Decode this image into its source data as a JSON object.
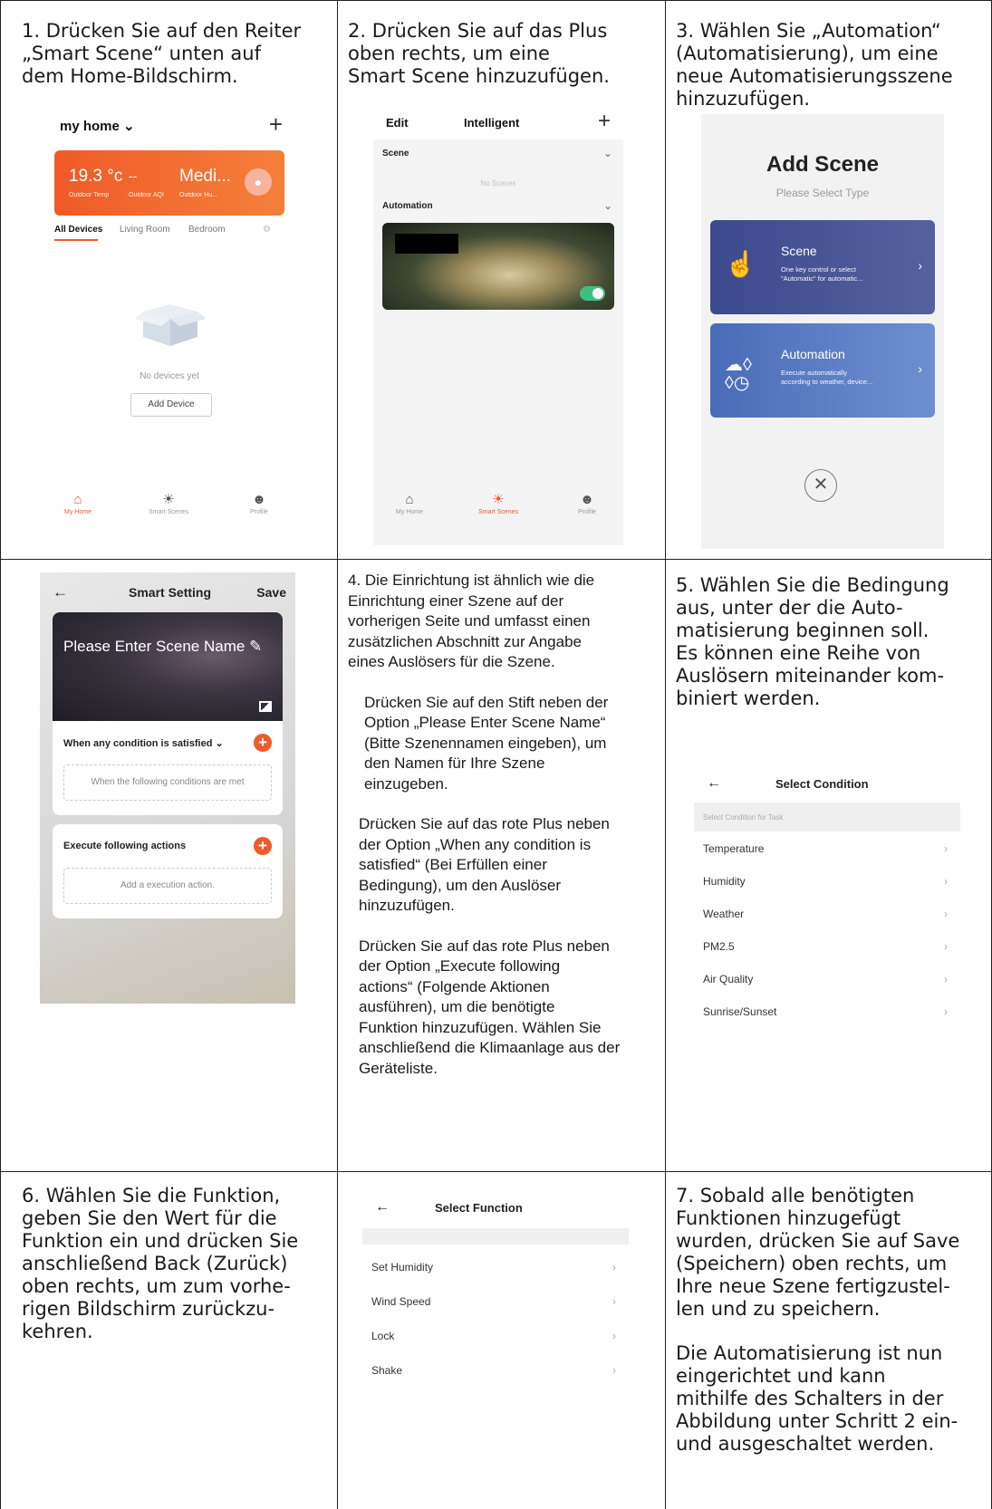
{
  "cells": {
    "c1": "1. Drücken Sie auf den Reiter\n„Smart Scene“ unten auf\ndem Home-Bildschirm.",
    "c2": "2. Drücken Sie auf das Plus\noben rechts, um eine\nSmart Scene hinzuzufügen.",
    "c3": "3. Wählen Sie „Automation“\n(Automatisierung), um eine\nneue Automatisierungsszene\nhinzuzufügen.",
    "c4": [
      "4. Die Einrichtung ist ähnlich wie die\nEinrichtung einer Szene auf der\nvorherigen Seite und umfasst einen\nzusätzlichen Abschnitt zur Angabe\neines Auslösers für die Szene.",
      "Drücken Sie auf den Stift neben der\nOption „Please Enter Scene Name“\n(Bitte Szenennamen eingeben), um\nden Namen für Ihre Szene\neinzugeben.",
      "Drücken Sie auf das rote Plus neben\nder Option „When any condition is\nsatisfied“ (Bei Erfüllen einer\nBedingung), um den Auslöser\nhinzuzufügen.",
      "Drücken Sie auf das rote Plus neben\nder Option „Execute following\nactions“ (Folgende Aktionen\nausführen), um die benötigte\nFunktion hinzuzufügen. Wählen Sie\nanschließend die Klimaanlage aus der\nGeräteliste."
    ],
    "c5": "5. Wählen Sie die Bedingung\naus, unter der die Auto-\nmatisierung beginnen soll.\nEs können eine Reihe von\nAuslösern miteinander kom-\nbiniert werden.",
    "c6": "6. Wählen Sie die Funktion,\ngeben Sie den Wert für die\nFunktion ein und drücken Sie\nanschließend Back (Zurück)\noben rechts, um zum vorhe-\nrigen Bildschirm zurückzu-\nkehren.",
    "c7a": "7. Sobald alle benötigten\nFunktionen hinzugefügt\nwurden, drücken Sie auf Save\n(Speichern) oben rechts, um\nIhre neue Szene fertigzustel-\nlen und zu speichern.",
    "c7b": "Die Automatisierung ist nun\neingerichtet und kann\nmithilfe des Schalters in der\nAbbildung unter Schritt 2 ein-\nund ausgeschaltet werden."
  },
  "screen1": {
    "home": "my home ⌄",
    "plus": "+",
    "temp": "19.3 °c",
    "temp_label": "Outdoor Temp",
    "aqi": "--",
    "aqi_label": "Outdoor AQI",
    "hum": "Medi...",
    "hum_label": "Outdoor Hu...",
    "tabs": [
      "All Devices",
      "Living Room",
      "Bedroom"
    ],
    "no_devices": "No devices yet",
    "add_device": "Add Device",
    "nav": [
      "My Home",
      "Smart Scenes",
      "Profile"
    ]
  },
  "screen2": {
    "edit": "Edit",
    "title": "Intelligent",
    "plus": "+",
    "scene": "Scene",
    "no_scenes": "No Scenes",
    "automation": "Automation",
    "nav": [
      "My Home",
      "Smart Scenes",
      "Profile"
    ]
  },
  "screen3": {
    "title": "Add Scene",
    "subtitle": "Please Select Type",
    "scene_title": "Scene",
    "scene_desc": "One key control or select\n\"Automatic\" for automatic...",
    "auto_title": "Automation",
    "auto_desc": "Execute automatically\naccording to weather, device...",
    "close": "✕"
  },
  "screen4": {
    "title": "Smart Setting",
    "save": "Save",
    "back": "←",
    "name_placeholder": "Please Enter Scene Name ✎",
    "condition_label": "When any condition is satisfied ⌄",
    "condition_box": "When the following conditions are met",
    "actions_label": "Execute following actions",
    "actions_box": "Add a execution action."
  },
  "screen5": {
    "back": "←",
    "title": "Select Condition",
    "section": "Select Condition for Task",
    "items": [
      "Temperature",
      "Humidity",
      "Weather",
      "PM2.5",
      "Air Quality",
      "Sunrise/Sunset"
    ]
  },
  "screen6": {
    "back": "←",
    "title": "Select Function",
    "items": [
      "Set Humidity",
      "Wind Speed",
      "Lock",
      "Shake"
    ]
  },
  "colors": {
    "accent_orange": "#f05a28",
    "toggle_green": "#3fbf7f",
    "scene_card": "#3b4a8c",
    "automation_card": "#4a6cb8"
  }
}
